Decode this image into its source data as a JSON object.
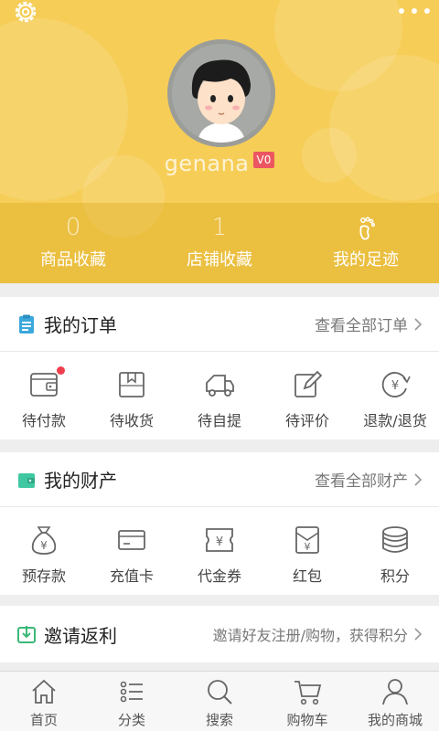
{
  "header": {
    "username": "genana",
    "level": "V0",
    "icons": {
      "settings": "gear-icon",
      "more": "more-dots-icon",
      "avatar": "cartoon-boy-avatar"
    },
    "colors": {
      "background": "#f6cd57",
      "badge": "#ec5660"
    },
    "stats": [
      {
        "value": "0",
        "label": "商品收藏"
      },
      {
        "value": "1",
        "label": "店铺收藏"
      },
      {
        "label": "我的足迹",
        "icon": "footprint-icon"
      }
    ]
  },
  "orders": {
    "title": "我的订单",
    "more": "查看全部订单",
    "icon": "clipboard-icon",
    "items": [
      {
        "label": "待付款",
        "icon": "wallet-icon",
        "has_dot": true
      },
      {
        "label": "待收货",
        "icon": "package-icon"
      },
      {
        "label": "待自提",
        "icon": "truck-icon"
      },
      {
        "label": "待评价",
        "icon": "edit-icon"
      },
      {
        "label": "退款/退货",
        "icon": "refund-icon"
      }
    ]
  },
  "assets": {
    "title": "我的财产",
    "more": "查看全部财产",
    "icon": "wallet-icon",
    "items": [
      {
        "label": "预存款",
        "icon": "money-bag-icon"
      },
      {
        "label": "充值卡",
        "icon": "card-icon"
      },
      {
        "label": "代金券",
        "icon": "voucher-icon"
      },
      {
        "label": "红包",
        "icon": "red-envelope-icon"
      },
      {
        "label": "积分",
        "icon": "coins-icon"
      }
    ]
  },
  "invite": {
    "title": "邀请返利",
    "more": "邀请好友注册/购物，获得积分",
    "icon": "download-box-icon"
  },
  "tabbar": [
    {
      "label": "首页",
      "icon": "home-icon"
    },
    {
      "label": "分类",
      "icon": "list-icon"
    },
    {
      "label": "搜索",
      "icon": "search-icon"
    },
    {
      "label": "购物车",
      "icon": "cart-icon"
    },
    {
      "label": "我的商城",
      "icon": "user-icon"
    }
  ]
}
